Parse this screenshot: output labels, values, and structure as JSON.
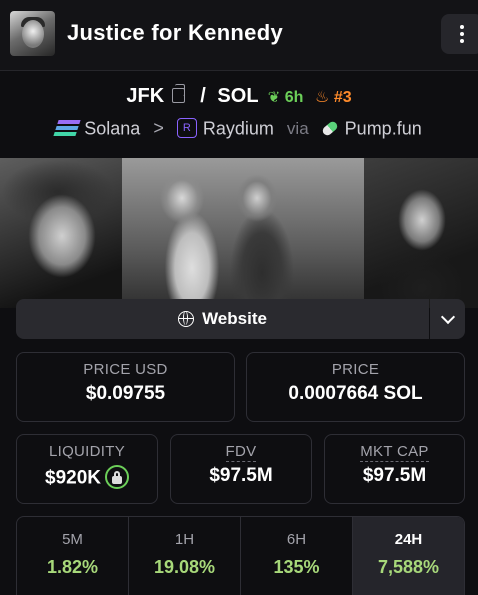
{
  "header": {
    "title": "Justice for Kennedy"
  },
  "pair": {
    "base": "JFK",
    "separator": "/",
    "quote": "SOL",
    "age": "6h",
    "rank": "#3"
  },
  "route": {
    "chain": "Solana",
    "dex": "Raydium",
    "via": "via",
    "launchpad": "Pump.fun"
  },
  "links": {
    "website": "Website"
  },
  "stats": {
    "price_usd": {
      "label": "PRICE USD",
      "value": "$0.09755"
    },
    "price": {
      "label": "PRICE",
      "value": "0.0007664 SOL"
    },
    "liquidity": {
      "label": "LIQUIDITY",
      "value": "$920K"
    },
    "fdv": {
      "label": "FDV",
      "value": "$97.5M"
    },
    "mkt_cap": {
      "label": "MKT CAP",
      "value": "$97.5M"
    }
  },
  "changes": [
    {
      "label": "5M",
      "value": "1.82%"
    },
    {
      "label": "1H",
      "value": "19.08%"
    },
    {
      "label": "6H",
      "value": "135%"
    },
    {
      "label": "24H",
      "value": "7,588%"
    }
  ],
  "colors": {
    "positive": "#a7d87a",
    "age": "#6ccf59",
    "rank": "#ff8b2b",
    "background": "#0e0e11"
  },
  "icons": [
    "token-avatar",
    "kebab-menu-icon",
    "copy-icon",
    "sprout-icon",
    "flame-icon",
    "solana-icon",
    "chevron-right-icon",
    "raydium-icon",
    "pill-icon",
    "globe-icon",
    "chevron-down-icon",
    "lock-icon"
  ]
}
